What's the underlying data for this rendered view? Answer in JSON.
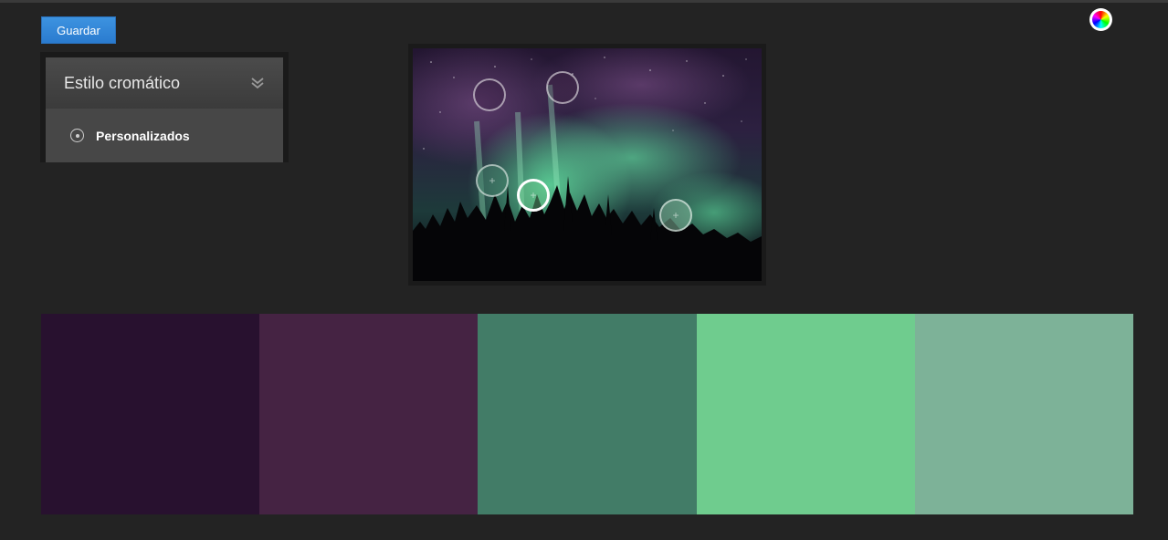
{
  "toolbar": {
    "save_label": "Guardar"
  },
  "color_style_panel": {
    "title": "Estilo cromático",
    "selected_option": "Personalizados"
  },
  "color_wheel_icon": "color-wheel",
  "swatches": [
    {
      "color": "#28112F"
    },
    {
      "color": "#452343"
    },
    {
      "color": "#427C67"
    },
    {
      "color": "#6FCC8E"
    },
    {
      "color": "#7DB298"
    }
  ],
  "pickers": [
    {
      "color": "#28112F",
      "active": false
    },
    {
      "color": "#452343",
      "active": false
    },
    {
      "color": "#427C67",
      "active": false
    },
    {
      "color": "#6FCC8E",
      "active": true
    },
    {
      "color": "#7DB298",
      "active": false
    }
  ]
}
